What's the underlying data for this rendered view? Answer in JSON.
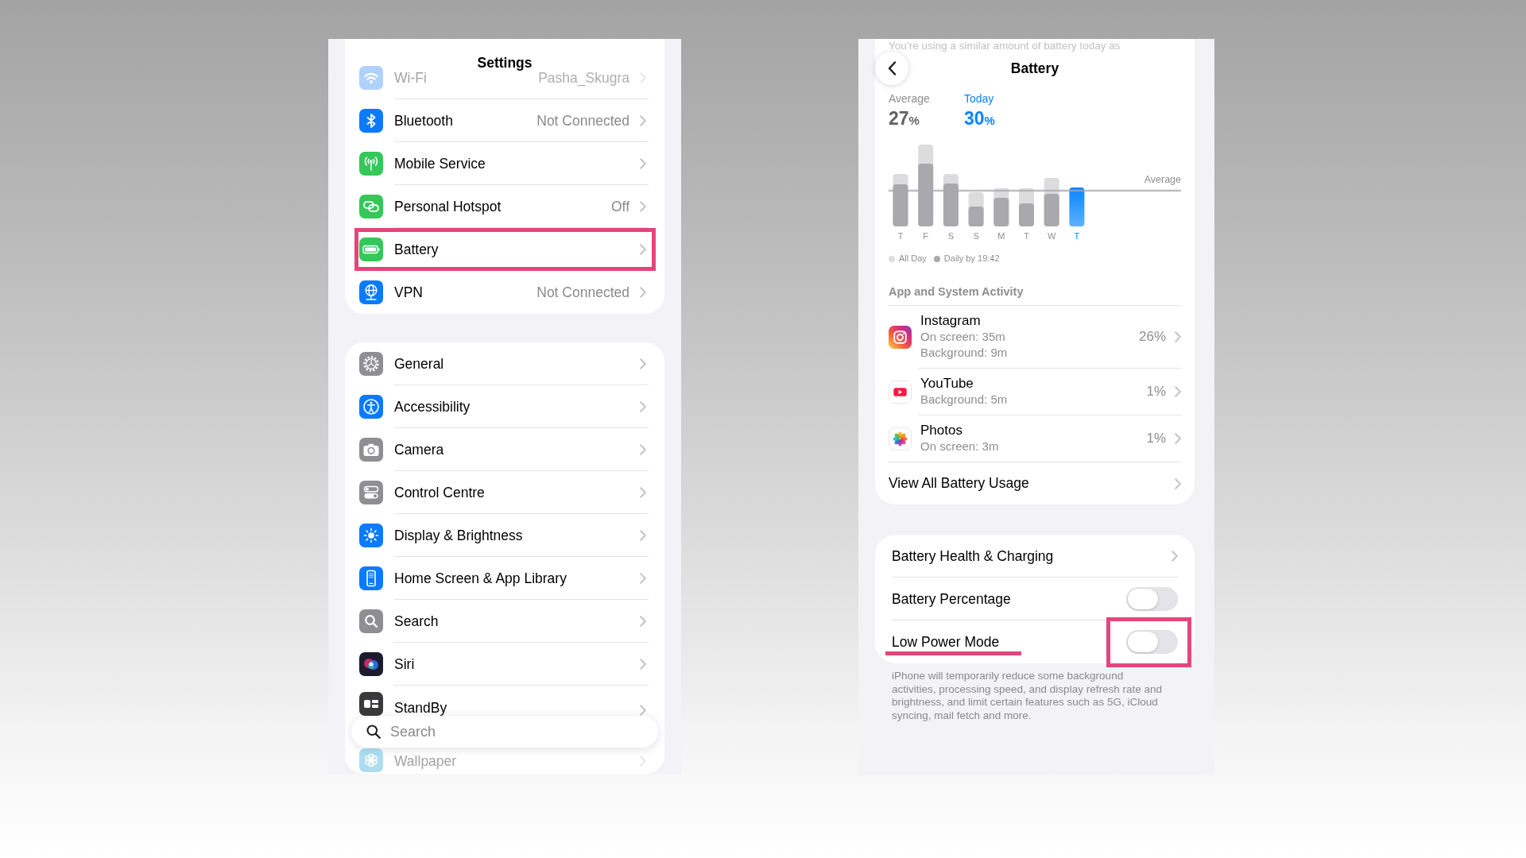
{
  "settings_screen": {
    "title": "Settings",
    "groups": [
      {
        "rows": [
          {
            "label": "Wi-Fi",
            "value": "Pasha_Skugra",
            "dimmed": true,
            "highlighted": false
          },
          {
            "label": "Bluetooth",
            "value": "Not Connected",
            "dimmed": false,
            "highlighted": false
          },
          {
            "label": "Mobile Service",
            "dimmed": false,
            "highlighted": false
          },
          {
            "label": "Personal Hotspot",
            "value": "Off",
            "dimmed": false,
            "highlighted": false
          },
          {
            "label": "Battery",
            "dimmed": false,
            "highlighted": true
          },
          {
            "label": "VPN",
            "value": "Not Connected",
            "dimmed": false,
            "highlighted": false
          }
        ]
      },
      {
        "rows": [
          {
            "label": "General",
            "dimmed": false,
            "highlighted": false
          },
          {
            "label": "Accessibility",
            "dimmed": false,
            "highlighted": false
          },
          {
            "label": "Camera",
            "dimmed": false,
            "highlighted": false
          },
          {
            "label": "Control Centre",
            "dimmed": false,
            "highlighted": false
          },
          {
            "label": "Display & Brightness",
            "dimmed": false,
            "highlighted": false
          },
          {
            "label": "Home Screen & App Library",
            "dimmed": false,
            "highlighted": false
          },
          {
            "label": "Search",
            "dimmed": false,
            "highlighted": false
          },
          {
            "label": "Siri",
            "dimmed": false,
            "highlighted": false
          },
          {
            "label": "StandBy",
            "dimmed": false,
            "highlighted": false
          },
          {
            "label": "Wallpaper",
            "dimmed": true,
            "highlighted": false
          }
        ]
      }
    ],
    "search": {
      "placeholder": "Search"
    }
  },
  "battery_screen": {
    "background_text": "You’re using a similar amount of battery today as",
    "title": "Battery",
    "stats": [
      {
        "label": "Average",
        "value": "27",
        "unit": "%",
        "today": false
      },
      {
        "label": "Today",
        "value": "30",
        "unit": "%",
        "today": true
      }
    ],
    "chart": {
      "reference_label": "Average",
      "days": [
        {
          "label": "T",
          "today": false
        },
        {
          "label": "F",
          "today": false
        },
        {
          "label": "S",
          "today": false
        },
        {
          "label": "S",
          "today": false
        },
        {
          "label": "M",
          "today": false
        },
        {
          "label": "T",
          "today": false
        },
        {
          "label": "W",
          "today": false
        },
        {
          "label": "T",
          "today": true
        }
      ],
      "legend": [
        {
          "label": "All Day",
          "color": "#dcdcdf"
        },
        {
          "label": "Daily by 19:42",
          "color": "#a9a9ad"
        }
      ]
    },
    "activity": {
      "heading": "App and System Activity",
      "apps": [
        {
          "name": "Instagram",
          "details": [
            "On screen: 35m",
            "Background: 9m"
          ],
          "share": "26%"
        },
        {
          "name": "YouTube",
          "details": [
            "Background: 5m"
          ],
          "share": "1%"
        },
        {
          "name": "Photos",
          "details": [
            "On screen: 3m"
          ],
          "share": "1%"
        }
      ],
      "link": "View All Battery Usage"
    },
    "settings": {
      "rows": [
        {
          "kind": "link",
          "label": "Battery Health & Charging",
          "highlighted": false
        },
        {
          "kind": "toggle",
          "label": "Battery Percentage",
          "on": false,
          "highlighted": false
        },
        {
          "kind": "toggle",
          "label": "Low Power Mode",
          "on": false,
          "highlighted": true
        }
      ],
      "footer": "iPhone will temporarily reduce some background activities, processing speed, and display refresh rate and brightness, and limit certain features such as 5G, iCloud syncing, mail fetch and more."
    }
  }
}
